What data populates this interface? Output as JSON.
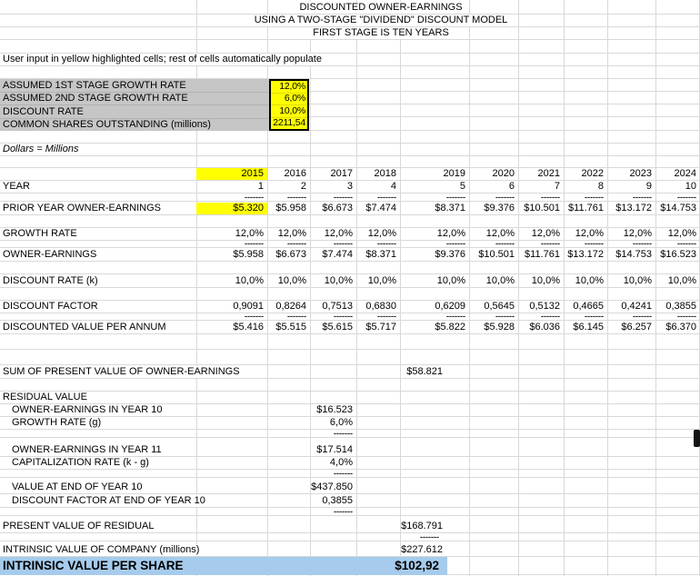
{
  "sheet": {
    "titles": [
      "DISCOUNTED OWNER-EARNINGS",
      "USING A TWO-STAGE \"DIVIDEND\" DISCOUNT MODEL",
      "FIRST STAGE IS TEN YEARS"
    ],
    "note": "User input in yellow highlighted cells; rest of cells automatically populate",
    "units_note": "Dollars = Millions",
    "inputs": [
      {
        "label": "ASSUMED 1ST STAGE GROWTH RATE",
        "value": "12,0%"
      },
      {
        "label": "ASSUMED 2ND STAGE GROWTH RATE",
        "value": "6,0%"
      },
      {
        "label": "DISCOUNT RATE",
        "value": "10,0%"
      },
      {
        "label": "COMMON SHARES OUTSTANDING (millions)",
        "value": "2211,54"
      }
    ],
    "year_table": {
      "years": [
        "2015",
        "2016",
        "2017",
        "2018",
        "2019",
        "2020",
        "2021",
        "2022",
        "2023",
        "2024"
      ],
      "year_label": "YEAR",
      "year_numbers": [
        "1",
        "2",
        "3",
        "4",
        "5",
        "6",
        "7",
        "8",
        "9",
        "10"
      ],
      "dashes": [
        "-------",
        "-------",
        "-------",
        "-------",
        "-------",
        "-------",
        "-------",
        "-------",
        "-------",
        "-------"
      ],
      "rows": [
        {
          "label": "PRIOR YEAR OWNER-EARNINGS",
          "values": [
            "$5.320",
            "$5.958",
            "$6.673",
            "$7.474",
            "$8.371",
            "$9.376",
            "$10.501",
            "$11.761",
            "$13.172",
            "$14.753"
          ]
        },
        {
          "label": "GROWTH RATE",
          "values": [
            "12,0%",
            "12,0%",
            "12,0%",
            "12,0%",
            "12,0%",
            "12,0%",
            "12,0%",
            "12,0%",
            "12,0%",
            "12,0%"
          ]
        },
        {
          "label": "OWNER-EARNINGS",
          "values": [
            "$5.958",
            "$6.673",
            "$7.474",
            "$8.371",
            "$9.376",
            "$10.501",
            "$11.761",
            "$13.172",
            "$14.753",
            "$16.523"
          ]
        },
        {
          "label": "DISCOUNT RATE (k)",
          "values": [
            "10,0%",
            "10,0%",
            "10,0%",
            "10,0%",
            "10,0%",
            "10,0%",
            "10,0%",
            "10,0%",
            "10,0%",
            "10,0%"
          ]
        },
        {
          "label": "DISCOUNT FACTOR",
          "values": [
            "0,9091",
            "0,8264",
            "0,7513",
            "0,6830",
            "0,6209",
            "0,5645",
            "0,5132",
            "0,4665",
            "0,4241",
            "0,3855"
          ]
        },
        {
          "label": "DISCOUNTED VALUE PER ANNUM",
          "values": [
            "$5.416",
            "$5.515",
            "$5.615",
            "$5.717",
            "$5.822",
            "$5.928",
            "$6.036",
            "$6.145",
            "$6.257",
            "$6.370"
          ]
        }
      ]
    },
    "summary": {
      "dash": "-------",
      "sum_pv_label": "SUM OF PRESENT VALUE OF OWNER-EARNINGS",
      "sum_pv_value": "$58.821",
      "residual_header": "RESIDUAL VALUE",
      "oe_y10_label": "OWNER-EARNINGS IN YEAR 10",
      "oe_y10_value": "$16.523",
      "growth_g_label": "GROWTH RATE (g)",
      "growth_g_value": "6,0%",
      "oe_y11_label": "OWNER-EARNINGS IN YEAR 11",
      "oe_y11_value": "$17.514",
      "cap_rate_label": "CAPITALIZATION RATE (k - g)",
      "cap_rate_value": "4,0%",
      "value_end_y10_label": "VALUE AT END OF YEAR 10",
      "value_end_y10_value": "$437.850",
      "df_end_y10_label": "DISCOUNT FACTOR AT END OF YEAR 10",
      "df_end_y10_value": "0,3855",
      "pv_residual_label": "PRESENT VALUE OF RESIDUAL",
      "pv_residual_value": "$168.791",
      "intrinsic_company_label": "INTRINSIC VALUE OF COMPANY (millions)",
      "intrinsic_company_value": "$227.612",
      "intrinsic_share_label": "INTRINSIC VALUE PER SHARE",
      "intrinsic_share_value": "$102,92"
    },
    "colors": {
      "input_highlight_yellow": "#FFFF00",
      "input_panel_gray": "#C6C6C6",
      "result_highlight_blue": "#A6CBEC",
      "grid_line": "#D9D9D9"
    }
  }
}
